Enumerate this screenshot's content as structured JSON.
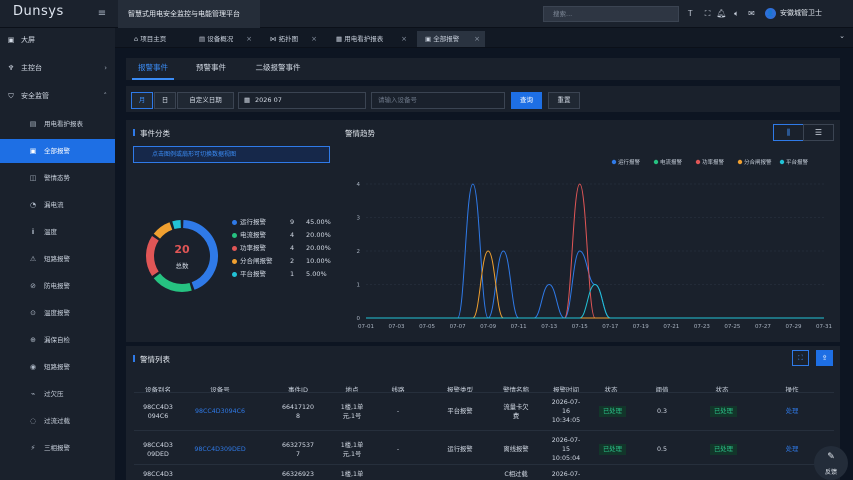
{
  "topbar": {
    "logo": "Dunsys",
    "app_title": "智慧式用电安全监控与电能管理平台",
    "search_placeholder": "搜索...",
    "user_name": "安徽城管卫士",
    "user_avatar": "👤"
  },
  "sidebar": {
    "top_items": [
      {
        "label": "大屏",
        "icon": "screen-icon"
      },
      {
        "label": "主控台",
        "icon": "dashboard-icon"
      },
      {
        "label": "安全监管",
        "icon": "shield-icon"
      }
    ],
    "sub_items": [
      {
        "label": "用电看护报表",
        "icon": "report-icon",
        "glyph": "▤"
      },
      {
        "label": "全部报警",
        "icon": "alarm-icon",
        "glyph": "▣"
      },
      {
        "label": "警情态势",
        "icon": "trend-icon",
        "glyph": "◫"
      },
      {
        "label": "漏电流",
        "icon": "leak-icon",
        "glyph": "◔"
      },
      {
        "label": "温度",
        "icon": "thermometer-icon",
        "glyph": "ⅱ"
      },
      {
        "label": "短路报警",
        "icon": "shortcircuit-icon",
        "glyph": "⚠"
      },
      {
        "label": "防电报警",
        "icon": "plug-icon",
        "glyph": "⊘"
      },
      {
        "label": "温度报警",
        "icon": "temp-alarm-icon",
        "glyph": "⊙"
      },
      {
        "label": "漏保自检",
        "icon": "selfcheck-icon",
        "glyph": "⊕"
      },
      {
        "label": "短路报警",
        "icon": "circuit-icon",
        "glyph": "◉"
      },
      {
        "label": "过欠压",
        "icon": "voltage-icon",
        "glyph": "⌁"
      },
      {
        "label": "过流过载",
        "icon": "overload-icon",
        "glyph": "◌"
      },
      {
        "label": "三相报警",
        "icon": "threephase-icon",
        "glyph": "⚡"
      }
    ]
  },
  "tabs": [
    {
      "label": "项目主页",
      "icon": "home-icon",
      "glyph": "⌂"
    },
    {
      "label": "设备概况",
      "icon": "device-icon",
      "glyph": "▤"
    },
    {
      "label": "拓扑图",
      "icon": "topology-icon",
      "glyph": "⋈"
    },
    {
      "label": "用电看护报表",
      "icon": "report-icon",
      "glyph": "▦"
    },
    {
      "label": "全部报警",
      "icon": "alarm-icon",
      "glyph": "▣"
    }
  ],
  "event_tabs": [
    "报警事件",
    "预警事件",
    "二级报警事件"
  ],
  "filter": {
    "month_label": "月",
    "day_label": "日",
    "custom_label": "自定义日期",
    "month_value": "2026 07",
    "device_placeholder": "请输入设备号",
    "query_label": "查询",
    "reset_label": "重置"
  },
  "category": {
    "title": "事件分类",
    "hint": "点击图例或扇形可切换数据视图",
    "total_value": "20",
    "total_label": "总数",
    "items": [
      {
        "name": "运行报警",
        "count": "9",
        "pct": "45.00%",
        "color": "#2f7ae8"
      },
      {
        "name": "电流报警",
        "count": "4",
        "pct": "20.00%",
        "color": "#26c281"
      },
      {
        "name": "功率报警",
        "count": "4",
        "pct": "20.00%",
        "color": "#e05656"
      },
      {
        "name": "分合闸报警",
        "count": "2",
        "pct": "10.00%",
        "color": "#f0a030"
      },
      {
        "name": "平台报警",
        "count": "1",
        "pct": "5.00%",
        "color": "#22c2d6"
      }
    ]
  },
  "trend": {
    "title": "警情趋势",
    "chart_icon": "bar-chart-icon",
    "list_icon": "list-icon"
  },
  "chart_data": {
    "type": "line",
    "title": "警情趋势",
    "x": [
      "07-01",
      "07-02",
      "07-03",
      "07-04",
      "07-05",
      "07-06",
      "07-07",
      "07-08",
      "07-09",
      "07-10",
      "07-11",
      "07-12",
      "07-13",
      "07-14",
      "07-15",
      "07-16",
      "07-17",
      "07-18",
      "07-19",
      "07-20",
      "07-21",
      "07-22",
      "07-23",
      "07-24",
      "07-25",
      "07-26",
      "07-27",
      "07-28",
      "07-29",
      "07-30",
      "07-31"
    ],
    "xticks": [
      "07-01",
      "07-03",
      "07-05",
      "07-07",
      "07-09",
      "07-11",
      "07-13",
      "07-15",
      "07-17",
      "07-19",
      "07-21",
      "07-23",
      "07-25",
      "07-27",
      "07-29",
      "07-31"
    ],
    "ylim": [
      0,
      4
    ],
    "yticks": [
      0,
      1,
      2,
      3,
      4
    ],
    "grid": true,
    "legend": "top-right",
    "smooth": true,
    "series": [
      {
        "name": "运行报警",
        "color": "#2f7ae8",
        "values": [
          0,
          0,
          0,
          0,
          0,
          0,
          0,
          4,
          0,
          2,
          0,
          0,
          1,
          0,
          2,
          1,
          0,
          0,
          0,
          0,
          0,
          0,
          0,
          0,
          0,
          0,
          0,
          0,
          0,
          0,
          0
        ]
      },
      {
        "name": "电流报警",
        "color": "#26c281",
        "values": [
          0,
          0,
          0,
          0,
          0,
          0,
          0,
          0,
          0,
          0,
          0,
          0,
          0,
          0,
          0,
          0,
          0,
          0,
          0,
          0,
          0,
          0,
          0,
          0,
          0,
          0,
          0,
          0,
          0,
          0,
          0
        ]
      },
      {
        "name": "功率报警",
        "color": "#e05656",
        "values": [
          0,
          0,
          0,
          0,
          0,
          0,
          0,
          0,
          0,
          0,
          0,
          0,
          0,
          0,
          4,
          0,
          0,
          0,
          0,
          0,
          0,
          0,
          0,
          0,
          0,
          0,
          0,
          0,
          0,
          0,
          0
        ]
      },
      {
        "name": "分合闸报警",
        "color": "#f0a030",
        "values": [
          0,
          0,
          0,
          0,
          0,
          0,
          0,
          0,
          2,
          0,
          0,
          0,
          0,
          0,
          0,
          0,
          0,
          0,
          0,
          0,
          0,
          0,
          0,
          0,
          0,
          0,
          0,
          0,
          0,
          0,
          0
        ]
      },
      {
        "name": "平台报警",
        "color": "#22c2d6",
        "values": [
          0,
          0,
          0,
          0,
          0,
          0,
          0,
          0,
          0,
          0,
          0,
          0,
          0,
          0,
          0,
          1,
          0,
          0,
          0,
          0,
          0,
          0,
          0,
          0,
          0,
          0,
          0,
          0,
          0,
          0,
          0
        ]
      }
    ]
  },
  "alarm_list": {
    "title": "警情列表",
    "fullscreen_icon": "expand-icon",
    "export_icon": "export-icon",
    "columns": [
      "设备别名",
      "设备号",
      "事件ID",
      "地点",
      "线路",
      "报警类型",
      "警情名称",
      "报警时间",
      "状态",
      "阈值",
      "状态",
      "操作"
    ],
    "rows": [
      {
        "alias": "98CC4D3\n094C6",
        "device": "98CC4D3094C6",
        "event_id": "66417120\n8",
        "place": "1楼,1单\n元,1号",
        "line": "-",
        "type": "平台报警",
        "name": "流量卡欠\n费",
        "time": "2026-07-\n16\n10:34:05",
        "status": "已处理",
        "threshold": "0.3",
        "status2": "已处理",
        "action": "处理"
      },
      {
        "alias": "98CC4D3\n09DED",
        "device": "98CC4D309DED",
        "event_id": "66327537\n7",
        "place": "1楼,1单\n元,1号",
        "line": "-",
        "type": "运行报警",
        "name": "离线报警",
        "time": "2026-07-\n15\n10:05:04",
        "status": "已处理",
        "threshold": "0.5",
        "status2": "已处理",
        "action": "处理"
      },
      {
        "alias": "98CC4D3",
        "device": "",
        "event_id": "66326923",
        "place": "1楼,1单",
        "line": "",
        "type": "",
        "name": "C相过载",
        "time": "2026-07-",
        "status": "",
        "threshold": "",
        "status2": "",
        "action": ""
      }
    ]
  },
  "feedback": {
    "label": "反馈",
    "icon": "edit-icon"
  }
}
